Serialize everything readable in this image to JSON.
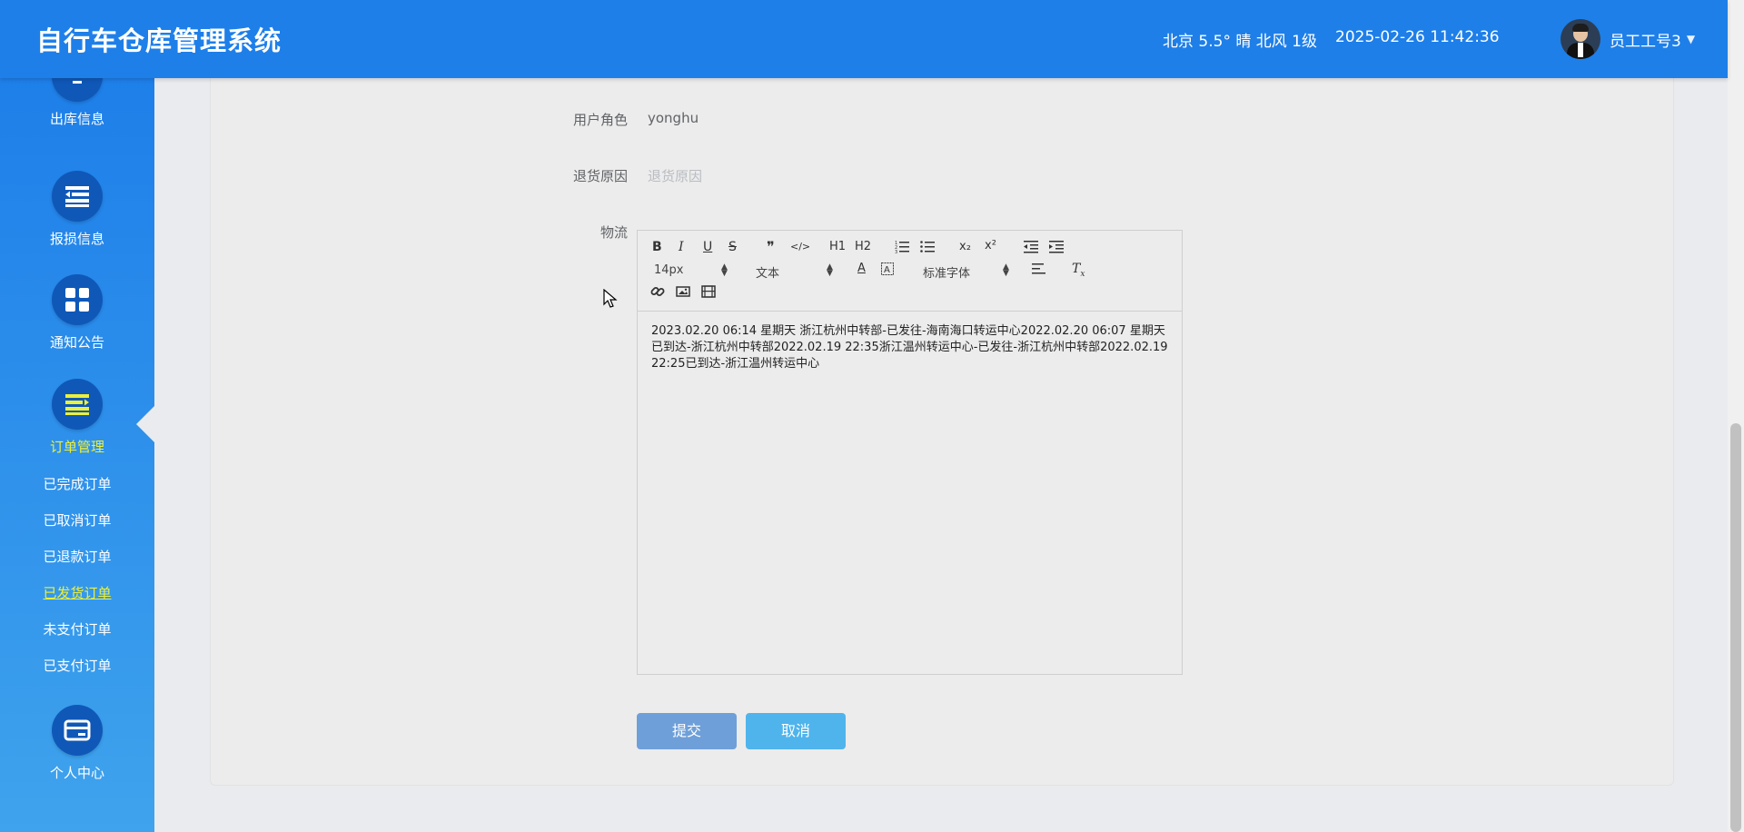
{
  "header": {
    "title": "自行车仓库管理系统",
    "weather": "北京 5.5° 晴 北风 1级",
    "datetime": "2025-02-26 11:42:36",
    "user_name": "员工工号3",
    "caret": "▼"
  },
  "sidebar": {
    "top_item": "出库信息",
    "damage_item": "报损信息",
    "notice_item": "通知公告",
    "order_item": "订单管理",
    "sub_items": [
      "已完成订单",
      "已取消订单",
      "已退款订单",
      "已发货订单",
      "未支付订单",
      "已支付订单"
    ],
    "profile_item": "个人中心"
  },
  "form": {
    "role_label": "用户角色",
    "role_value": "yonghu",
    "reason_label": "退货原因",
    "reason_placeholder": "退货原因",
    "logistics_label": "物流"
  },
  "editor": {
    "toolbar": {
      "bold": "B",
      "italic": "I",
      "underline": "U",
      "strike": "S",
      "quote": "❞",
      "code": "</>",
      "h1": "H1",
      "h2": "H2",
      "subscript": "x₂",
      "superscript": "x²",
      "size": "14px",
      "header": "文本",
      "font": "标准字体"
    },
    "content": "2023.02.20 06:14 星期天 浙江杭州中转部-已发往-海南海口转运中心2022.02.20 06:07 星期天 已到达-浙江杭州中转部2022.02.19 22:35浙江温州转运中心-已发往-浙江杭州中转部2022.02.19 22:25已到达-浙江温州转运中心"
  },
  "buttons": {
    "submit": "提交",
    "cancel": "取消"
  },
  "colors": {
    "header": "#1e7fe9",
    "sidebar_icon": "#0f58b8",
    "active": "#ecf03a",
    "submit": "#6e9fd9",
    "cancel": "#4fb4ec"
  }
}
